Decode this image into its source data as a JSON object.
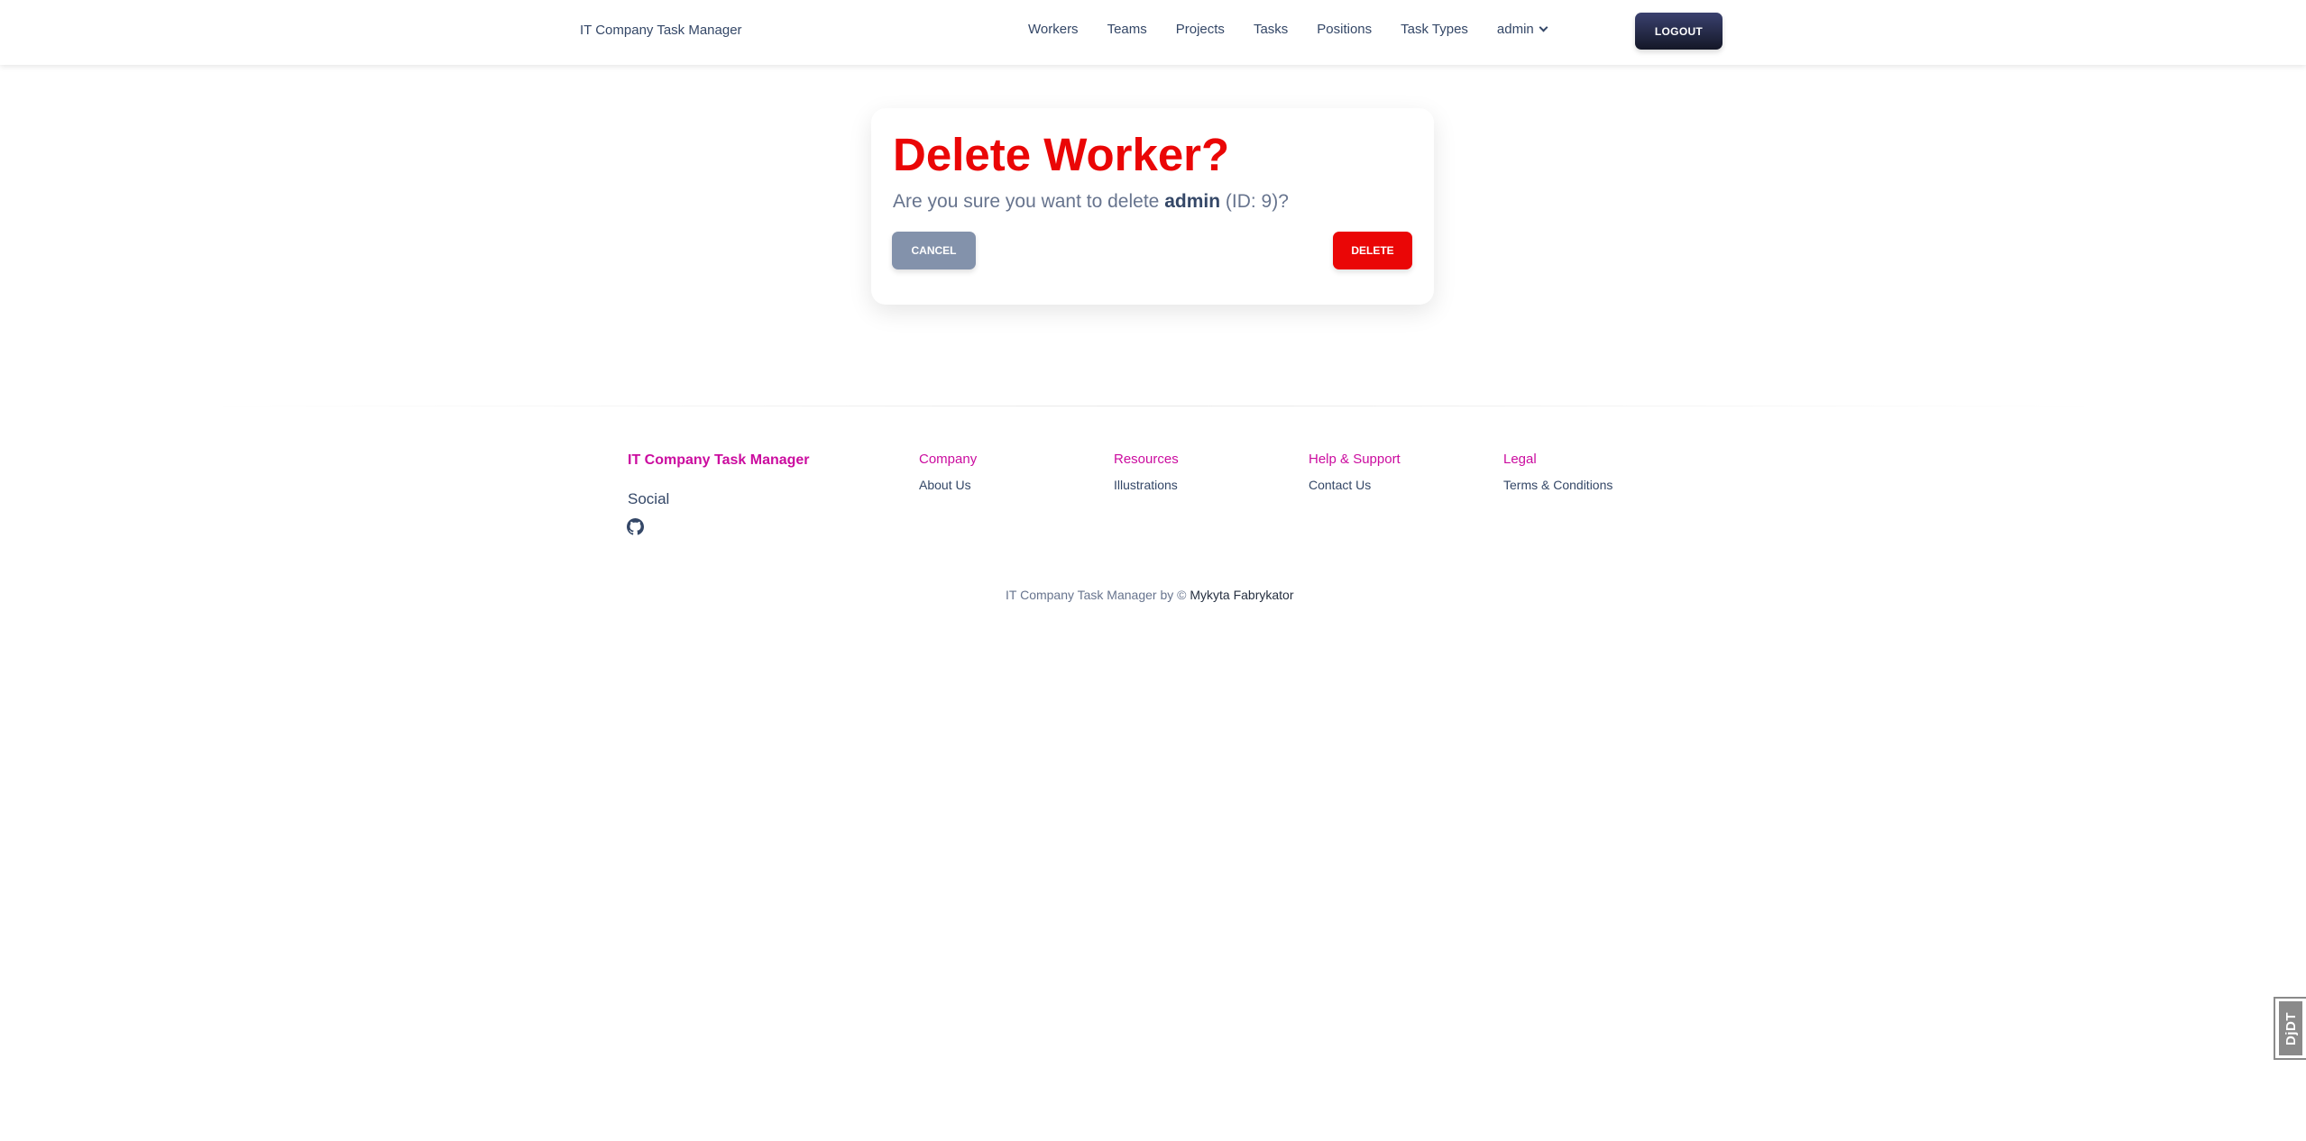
{
  "navbar": {
    "brand": "IT Company Task Manager",
    "links": [
      "Workers",
      "Teams",
      "Projects",
      "Tasks",
      "Positions",
      "Task Types"
    ],
    "user_dropdown": "admin",
    "logout_label": "LOGOUT"
  },
  "card": {
    "title": "Delete Worker?",
    "text_before": "Are you sure you want to delete ",
    "username": "admin",
    "text_after": " (ID: 9)?",
    "cancel_label": "CANCEL",
    "delete_label": "DELETE"
  },
  "footer": {
    "brand": "IT Company Task Manager",
    "social_label": "Social",
    "social_icon": "github-icon",
    "columns": [
      {
        "title": "Company",
        "link": "About Us"
      },
      {
        "title": "Resources",
        "link": "Illustrations"
      },
      {
        "title": "Help & Support",
        "link": "Contact Us"
      },
      {
        "title": "Legal",
        "link": "Terms & Conditions"
      }
    ],
    "copyright_text": "IT Company Task Manager by © ",
    "copyright_author": "Mykyta Fabrykator"
  },
  "debug_toolbar": {
    "label": "DjDT"
  },
  "colors": {
    "danger": "#ea0606",
    "secondary": "#8392ab",
    "primary_text": "#344767",
    "accent": "#cb0c9f",
    "dark": "#141727"
  }
}
